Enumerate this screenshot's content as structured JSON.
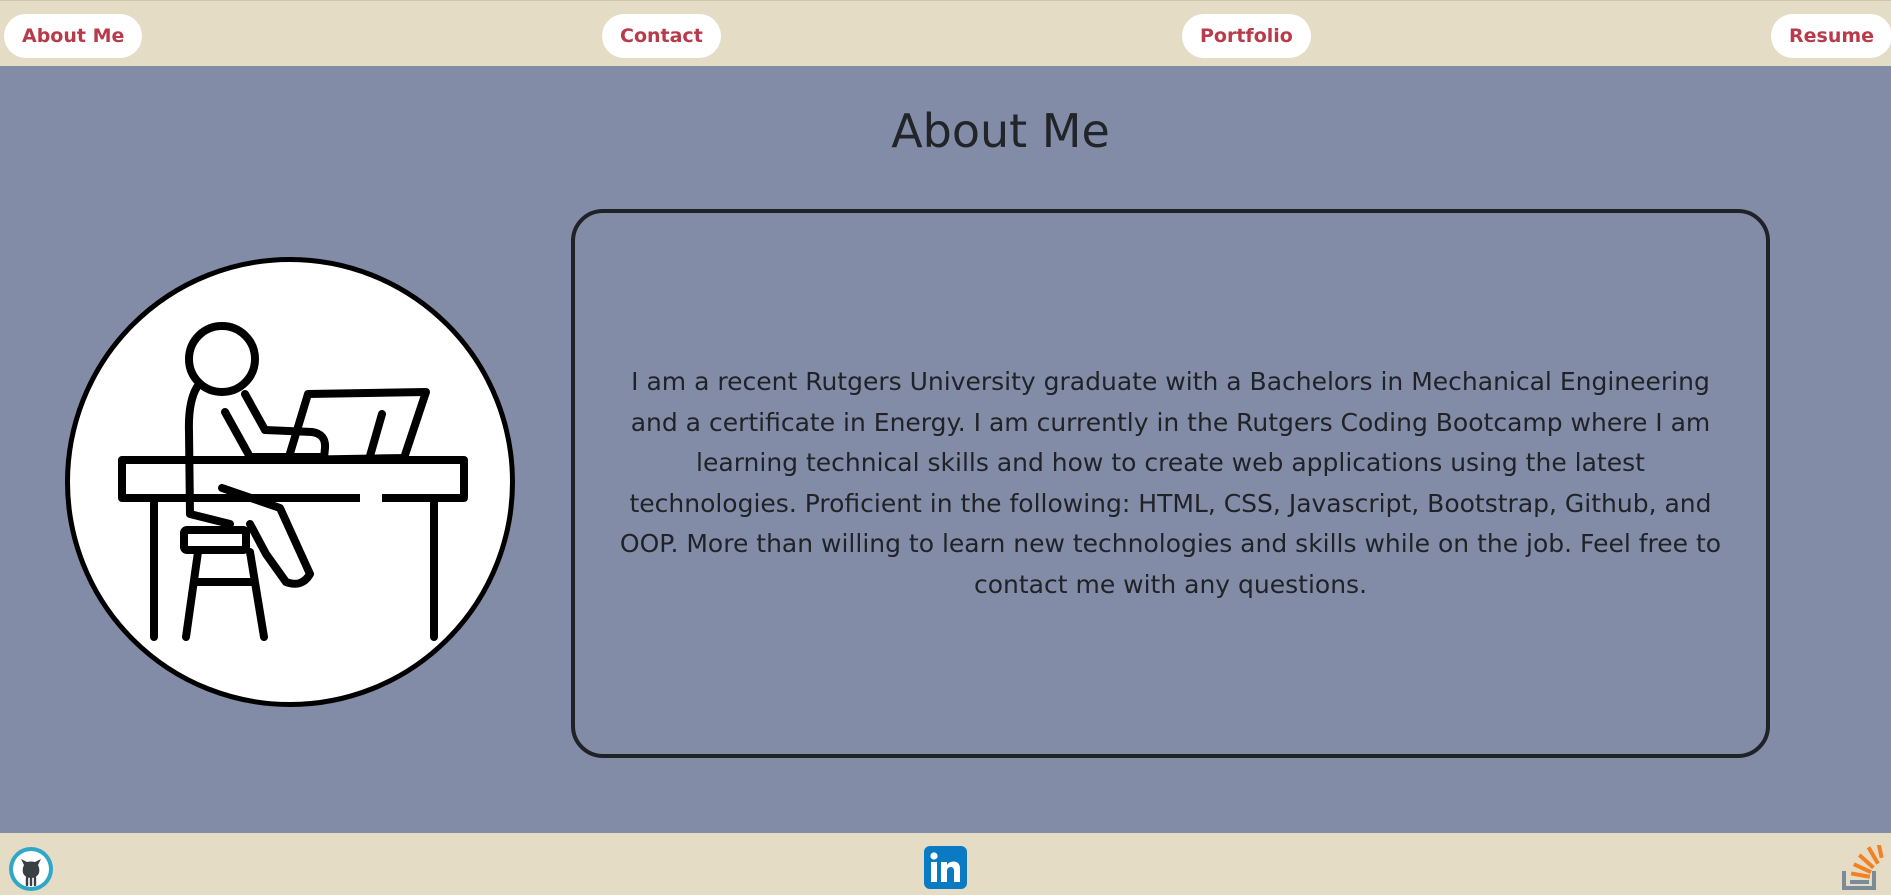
{
  "nav": {
    "about_label": "About Me",
    "contact_label": "Contact",
    "portfolio_label": "Portfolio",
    "resume_label": "Resume"
  },
  "main": {
    "title": "About Me",
    "avatar_icon": "person-at-laptop-desk-icon",
    "bio": "I am a recent Rutgers University graduate with a Bachelors in Mechanical Engineering and a certificate in Energy. I am currently in the Rutgers Coding Bootcamp where I am learning technical skills and how to create web applications using the latest technologies. Proficient in the following: HTML, CSS, Javascript, Bootstrap, Github, and OOP. More than willing to learn new technologies and skills while on the job. Feel free to contact me with any questions."
  },
  "footer": {
    "links": [
      {
        "name": "github",
        "icon": "github-icon"
      },
      {
        "name": "linkedin",
        "icon": "linkedin-icon"
      },
      {
        "name": "stackoverflow",
        "icon": "stackoverflow-icon"
      }
    ]
  },
  "colors": {
    "background": "#828ca6",
    "nav_background": "#e4dcc4",
    "nav_text": "#b83a4b",
    "text": "#212529",
    "linkedin": "#0a7bc2",
    "stackoverflow_orange": "#f48024",
    "stackoverflow_gray": "#7b8b97"
  }
}
